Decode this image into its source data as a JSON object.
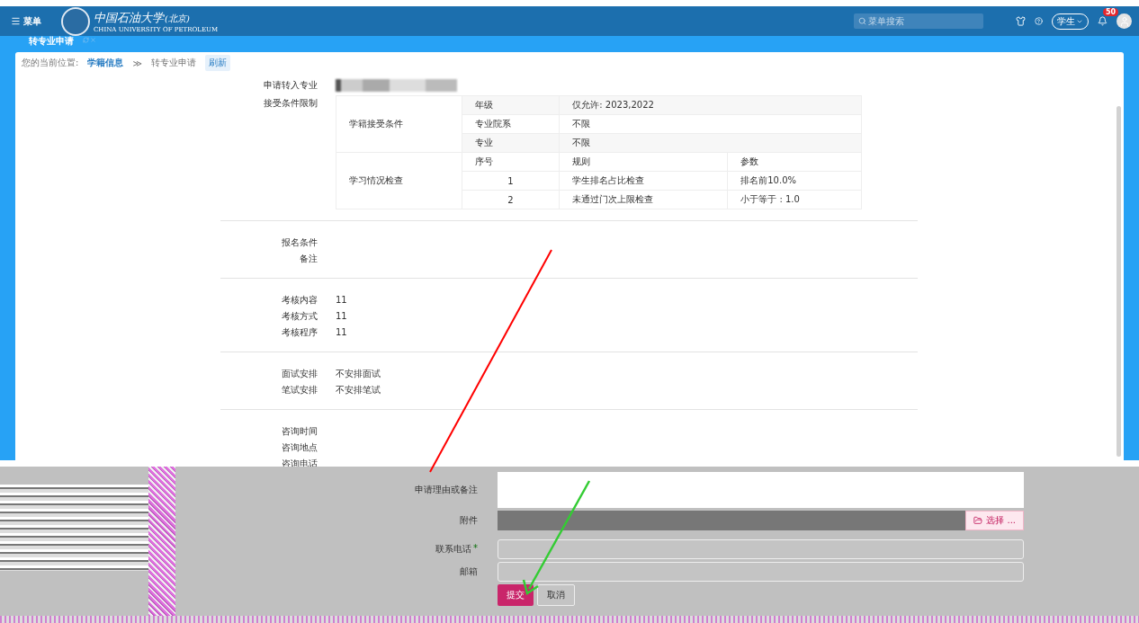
{
  "header": {
    "menu_label": "菜单",
    "logo_text": "中国石油大学",
    "logo_sub": "(北京)",
    "logo_en": "CHINA UNIVERSITY OF PETROLEUM",
    "search": {
      "placeholder": "菜单搜索"
    },
    "role": "学生",
    "notifications": "50"
  },
  "page_title": "转专业申请",
  "breadcrumb": {
    "label": "您的当前位置:",
    "items": [
      "学籍信息",
      "转专业申请"
    ],
    "separator": "≫",
    "refresh": "刷新"
  },
  "target_major": {
    "label": "申请转入专业"
  },
  "conditions": {
    "label": "接受条件限制",
    "status_group": {
      "title": "学籍接受条件",
      "rows": [
        {
          "name": "年级",
          "value": "仅允许: 2023,2022"
        },
        {
          "name": "专业院系",
          "value": "不限"
        },
        {
          "name": "专业",
          "value": "不限"
        }
      ]
    },
    "study_group": {
      "title": "学习情况检查",
      "columns": [
        "序号",
        "规则",
        "参数"
      ],
      "rows": [
        [
          "1",
          "学生排名占比检查",
          "排名前10.0%"
        ],
        [
          "2",
          "未通过门次上限检查",
          "小于等于 : 1.0"
        ]
      ]
    }
  },
  "sections": [
    [
      {
        "label": "报名条件"
      },
      {
        "label": "备注"
      }
    ],
    [
      {
        "label": "考核内容",
        "value": "11"
      },
      {
        "label": "考核方式",
        "value": "11"
      },
      {
        "label": "考核程序",
        "value": "11"
      }
    ],
    [
      {
        "label": "面试安排",
        "value": "不安排面试"
      },
      {
        "label": "笔试安排",
        "value": "不安排笔试"
      }
    ],
    [
      {
        "label": "咨询时间"
      },
      {
        "label": "咨询地点"
      },
      {
        "label": "咨询电话"
      }
    ]
  ],
  "form": {
    "reason_label": "申请理由或备注",
    "attachment_label": "附件",
    "choose_button": "选择 ...",
    "phone_label": "联系电话",
    "required_mark": "*",
    "email_label": "邮箱",
    "submit": "提交",
    "cancel": "取消"
  }
}
